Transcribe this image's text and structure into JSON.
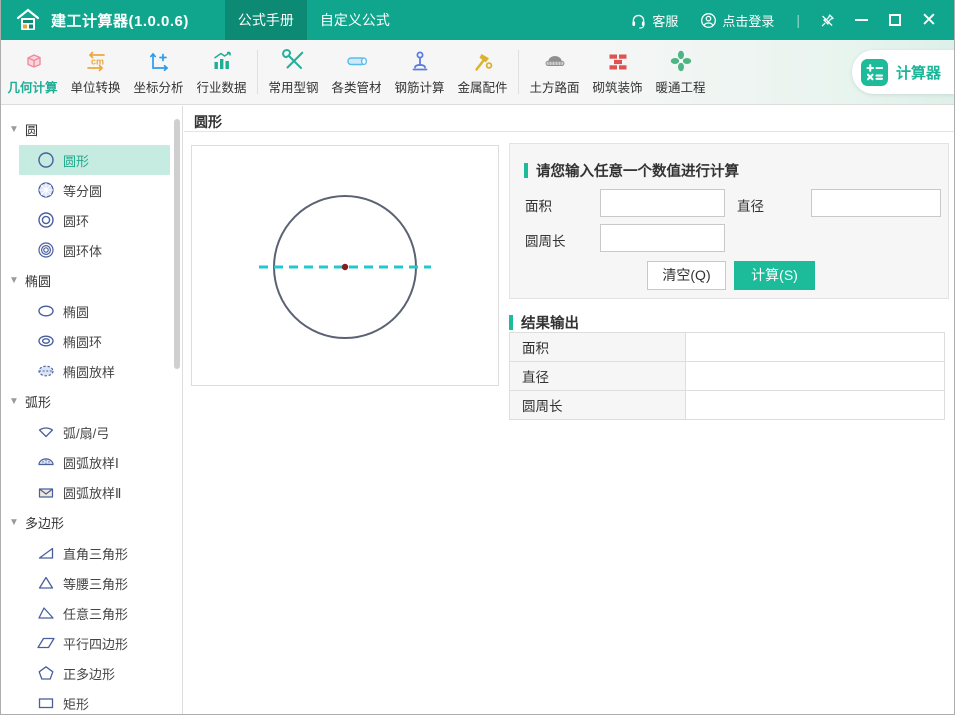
{
  "window": {
    "title": "建工计算器(1.0.0.6)"
  },
  "titlebar": {
    "tabs": [
      {
        "label": "公式手册",
        "active": true
      },
      {
        "label": "自定义公式",
        "active": false
      }
    ],
    "service_label": "客服",
    "login_label": "点击登录"
  },
  "toolbar": {
    "items": [
      {
        "label": "几何计算",
        "active": true
      },
      {
        "label": "单位转换",
        "active": false
      },
      {
        "label": "坐标分析",
        "active": false
      },
      {
        "label": "行业数据",
        "active": false
      },
      {
        "label": "常用型钢",
        "active": false
      },
      {
        "label": "各类管材",
        "active": false
      },
      {
        "label": "钢筋计算",
        "active": false
      },
      {
        "label": "金属配件",
        "active": false
      },
      {
        "label": "土方路面",
        "active": false
      },
      {
        "label": "砌筑装饰",
        "active": false
      },
      {
        "label": "暖通工程",
        "active": false
      }
    ],
    "calculator_button": "计算器"
  },
  "sidebar": {
    "groups": [
      {
        "label": "圆",
        "items": [
          {
            "label": "圆形",
            "selected": true
          },
          {
            "label": "等分圆",
            "selected": false
          },
          {
            "label": "圆环",
            "selected": false
          },
          {
            "label": "圆环体",
            "selected": false
          }
        ]
      },
      {
        "label": "椭圆",
        "items": [
          {
            "label": "椭圆",
            "selected": false
          },
          {
            "label": "椭圆环",
            "selected": false
          },
          {
            "label": "椭圆放样",
            "selected": false
          }
        ]
      },
      {
        "label": "弧形",
        "items": [
          {
            "label": "弧/扇/弓",
            "selected": false
          },
          {
            "label": "圆弧放样Ⅰ",
            "selected": false
          },
          {
            "label": "圆弧放样Ⅱ",
            "selected": false
          }
        ]
      },
      {
        "label": "多边形",
        "items": [
          {
            "label": "直角三角形",
            "selected": false
          },
          {
            "label": "等腰三角形",
            "selected": false
          },
          {
            "label": "任意三角形",
            "selected": false
          },
          {
            "label": "平行四边形",
            "selected": false
          },
          {
            "label": "正多边形",
            "selected": false
          },
          {
            "label": "矩形",
            "selected": false
          }
        ]
      }
    ]
  },
  "main": {
    "page_title": "圆形",
    "input_section": {
      "title": "请您输入任意一个数值进行计算",
      "fields": [
        {
          "label": "面积",
          "value": ""
        },
        {
          "label": "直径",
          "value": ""
        },
        {
          "label": "圆周长",
          "value": ""
        }
      ],
      "clear_button": "清空(Q)",
      "calc_button": "计算(S)"
    },
    "result_section": {
      "title": "结果输出",
      "rows": [
        {
          "label": "面积",
          "value": ""
        },
        {
          "label": "直径",
          "value": ""
        },
        {
          "label": "圆周长",
          "value": ""
        }
      ]
    }
  },
  "colors": {
    "titlebar_teal": "#0FA68D",
    "active_tab_teal": "#0C8A74",
    "accent_teal": "#1CBC9B",
    "selected_item_bg": "#C6EBE0",
    "selected_item_text": "#1FA98E",
    "sidebar_icon_blue": "#4A5F9E",
    "diagram_circle_stroke": "#5A6274",
    "diagram_diameter_dash": "#23C8CE",
    "diagram_center_dot": "#7E2020"
  }
}
